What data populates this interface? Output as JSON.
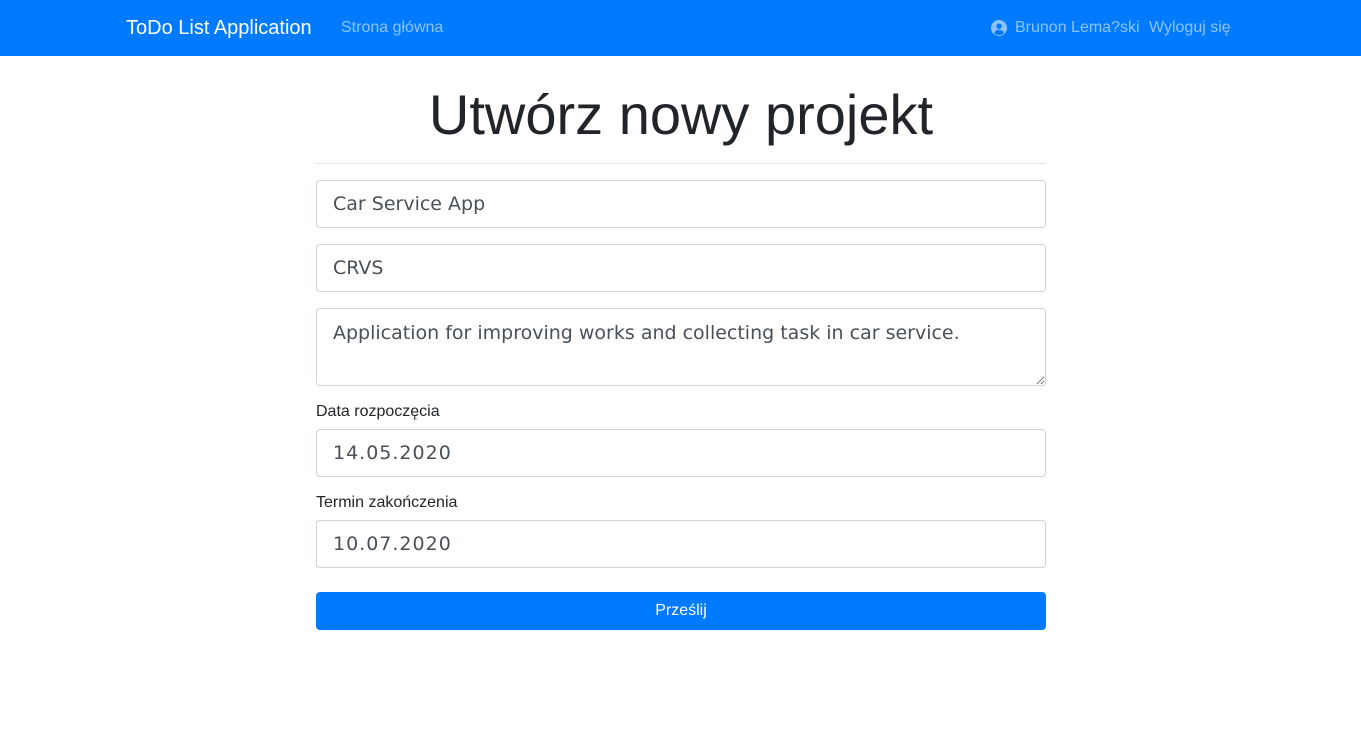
{
  "navbar": {
    "brand": "ToDo List Application",
    "home_link": "Strona główna",
    "user_name": "Brunon Lema?ski",
    "user_icon": "user-circle-icon",
    "logout_link": "Wyloguj się",
    "background_color": "#007bff"
  },
  "page": {
    "title": "Utwórz nowy projekt"
  },
  "form": {
    "name_value": "Car Service App",
    "code_value": "CRVS",
    "description_value": "Application for improving works and collecting task in car service.",
    "start_date_label": "Data rozpoczęcia",
    "start_date_value": "14.05.2020",
    "end_date_label": "Termin zakończenia",
    "end_date_value": "10.07.2020",
    "submit_label": "Prześlij",
    "accent_color": "#007bff"
  }
}
